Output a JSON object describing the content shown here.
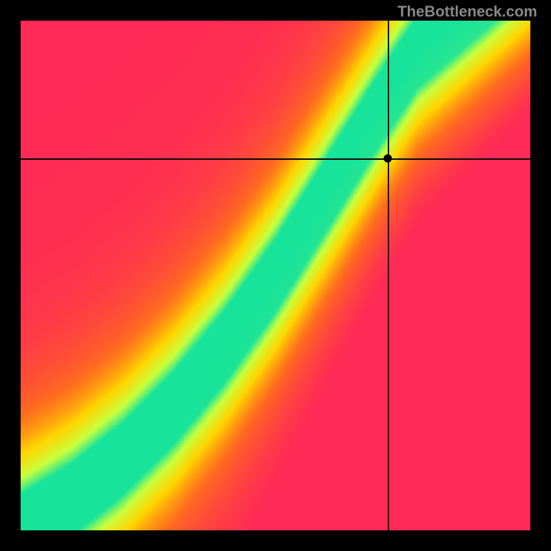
{
  "watermark": "TheBottleneck.com",
  "chart_data": {
    "type": "heatmap",
    "title": "",
    "xlabel": "",
    "ylabel": "",
    "xlim": [
      0,
      1
    ],
    "ylim": [
      0,
      1
    ],
    "grid": false,
    "legend": false,
    "crosshair": {
      "x": 0.72,
      "y": 0.73
    },
    "marker": {
      "x": 0.72,
      "y": 0.73
    },
    "colorscale": [
      {
        "t": 0.0,
        "hex": "#ff2a55"
      },
      {
        "t": 0.25,
        "hex": "#ff6a1f"
      },
      {
        "t": 0.5,
        "hex": "#ffd400"
      },
      {
        "t": 0.75,
        "hex": "#c8ff3d"
      },
      {
        "t": 1.0,
        "hex": "#17e39a"
      }
    ],
    "optimal_curve": [
      {
        "x": 0.0,
        "y": 0.0
      },
      {
        "x": 0.1,
        "y": 0.06
      },
      {
        "x": 0.2,
        "y": 0.14
      },
      {
        "x": 0.3,
        "y": 0.24
      },
      {
        "x": 0.4,
        "y": 0.36
      },
      {
        "x": 0.5,
        "y": 0.5
      },
      {
        "x": 0.6,
        "y": 0.66
      },
      {
        "x": 0.7,
        "y": 0.82
      },
      {
        "x": 0.78,
        "y": 0.94
      },
      {
        "x": 0.85,
        "y": 1.0
      }
    ],
    "band_width": 0.07
  }
}
